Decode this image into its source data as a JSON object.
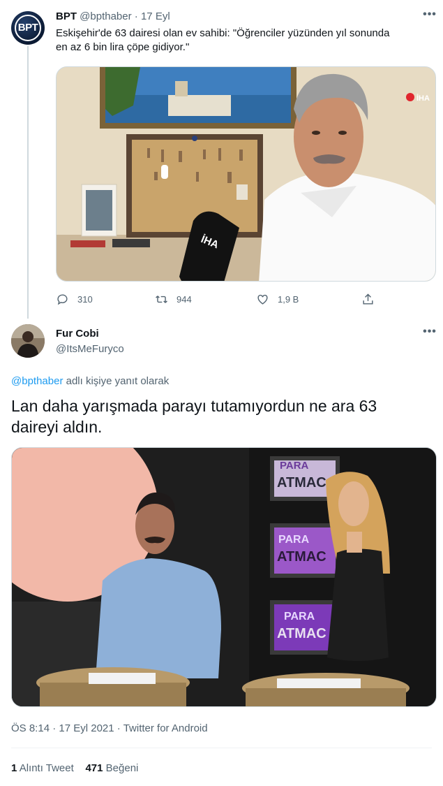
{
  "parent_tweet": {
    "avatar_text": "BPT",
    "name": "BPT",
    "handle": "@bpthaber",
    "separator": "·",
    "date": "17 Eyl",
    "text_line1": "Eskişehir'de 63 dairesi olan ev sahibi: \"Öğrenciler yüzünden yıl sonunda",
    "text_line2": "en az 6 bin lira çöpe gidiyor.\"",
    "media": {
      "mic_label": "İHA",
      "watermark": "İHA"
    },
    "actions": {
      "replies": "310",
      "retweets": "944",
      "likes": "1,9 B"
    }
  },
  "reply_tweet": {
    "name": "Fur Cobi",
    "handle": "@ItsMeFuryco",
    "reply_mention": "@bpthaber",
    "reply_suffix": "adlı kişiye yanıt olarak",
    "text_line1": "Lan daha yarışmada parayı tutamıyordun ne ara 63",
    "text_line2": "daireyi aldın.",
    "media": {
      "screen_top_line1": "PARA",
      "screen_top_line2": "ATMACA",
      "screen_mid_line1": "PARA",
      "screen_mid_line2": "ATMAC",
      "screen_bot_line1": "PARA",
      "screen_bot_line2": "ATMAC"
    },
    "time": "ÖS 8:14",
    "separator": "·",
    "date": "17 Eyl 2021",
    "source": "Twitter for Android",
    "quote_count": "1",
    "quote_label": "Alıntı Tweet",
    "like_count": "471",
    "like_label": "Beğeni"
  },
  "icons": {
    "more": "more-horizontal-icon",
    "reply": "reply-bubble-icon",
    "retweet": "retweet-icon",
    "like": "heart-icon",
    "share": "share-icon"
  },
  "colors": {
    "link": "#1d9bf0",
    "muted": "#536471",
    "text": "#0f1419"
  }
}
